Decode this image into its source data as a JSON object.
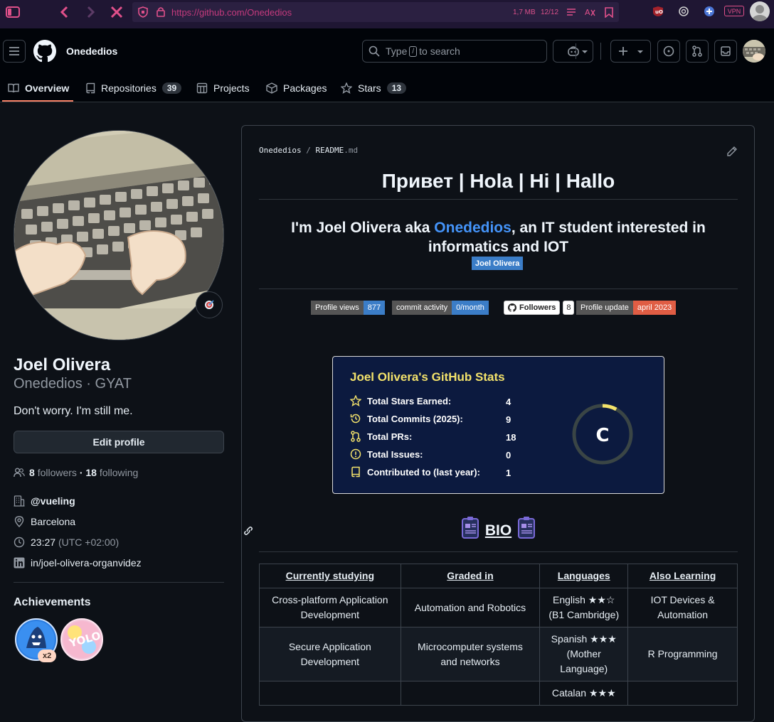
{
  "browser": {
    "url": "https://github.com/Onededios",
    "mem": "1,7 MB",
    "tab_count": "12/12",
    "vpn_label": "VPN"
  },
  "header": {
    "owner": "Onededios",
    "search_placeholder_pre": "Type",
    "search_key": "/",
    "search_placeholder_post": "to search"
  },
  "tabs": [
    {
      "label": "Overview"
    },
    {
      "label": "Repositories",
      "count": "39"
    },
    {
      "label": "Projects"
    },
    {
      "label": "Packages"
    },
    {
      "label": "Stars",
      "count": "13"
    }
  ],
  "profile": {
    "name": "Joel Olivera",
    "login_line": "Onededios · GYAT",
    "bio": "Don't worry. I'm still me.",
    "edit_label": "Edit profile",
    "followers_count": "8",
    "followers_label": "followers",
    "sep": "·",
    "following_count": "18",
    "following_label": "following",
    "company": "@vueling",
    "location": "Barcelona",
    "time": "23:27",
    "timezone": "(UTC +02:00)",
    "linkedin": "in/joel-olivera-organvidez",
    "achievements_title": "Achievements",
    "achievement_multiplier": "x2"
  },
  "readme": {
    "path_owner": "Onededios",
    "path_sep": "/",
    "path_file": "README",
    "path_ext": ".md",
    "heading": "Привет | Hola | Hi | Hallo",
    "intro_pre": "I'm Joel Olivera aka ",
    "intro_link": "Onededios",
    "intro_post": ", an IT student interested in informatics and IOT",
    "name_badge": "Joel Olivera",
    "badges": {
      "views_label": "Profile views",
      "views_value": "877",
      "commit_label": "commit activity",
      "commit_value": "0/month",
      "followers_label": "Followers",
      "followers_value": "8",
      "update_label": "Profile update",
      "update_value": "april 2023"
    },
    "stats": {
      "title": "Joel Olivera's GitHub Stats",
      "rows": [
        {
          "label": "Total Stars Earned:",
          "value": "4"
        },
        {
          "label": "Total Commits (2025):",
          "value": "9"
        },
        {
          "label": "Total PRs:",
          "value": "18"
        },
        {
          "label": "Total Issues:",
          "value": "0"
        },
        {
          "label": "Contributed to (last year):",
          "value": "1"
        }
      ],
      "rank": "C",
      "rank_progress": 0.08,
      "colors": {
        "title": "#f3e26b",
        "icon": "#f3e26b",
        "ring": "#f3e26b",
        "bg": "#0c1a3f"
      }
    },
    "bio_heading": "BIO",
    "table": {
      "headers": [
        "Currently studying",
        "Graded in",
        "Languages",
        "Also Learning"
      ],
      "rows": [
        [
          "Cross-platform Application Development",
          "Automation and Robotics",
          "English ★★☆ (B1 Cambridge)",
          "IOT Devices & Automation"
        ],
        [
          "Secure Application Development",
          "Microcomputer systems and networks",
          "Spanish ★★★ (Mother Language)",
          "R Programming"
        ],
        [
          "",
          "",
          "Catalan ★★★",
          ""
        ]
      ]
    }
  }
}
